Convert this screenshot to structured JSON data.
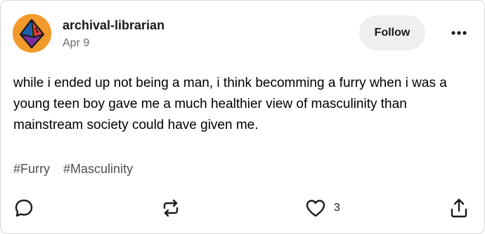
{
  "post": {
    "author": "archival-librarian",
    "date": "Apr 9",
    "follow_label": "Follow",
    "more_icon": "more-horizontal-icon",
    "body": "while i ended up not being a man, i think becomming a furry when i was a young teen boy gave me a much healthier view of masculinity than mainstream society could have given me.",
    "tags": [
      "#Furry",
      "#Masculinity"
    ],
    "like_count": "3"
  },
  "icons": {
    "avatar": "geometric-d10-avatar",
    "reply": "speech-bubble-icon",
    "reblog": "reblog-arrows-icon",
    "like": "heart-outline-icon",
    "share": "share-upload-icon"
  },
  "colors": {
    "avatar_bg": "#f39a2c",
    "follow_bg": "#efefef",
    "tag_text": "#4f4f4f",
    "muted_text": "#6b6b6b"
  }
}
